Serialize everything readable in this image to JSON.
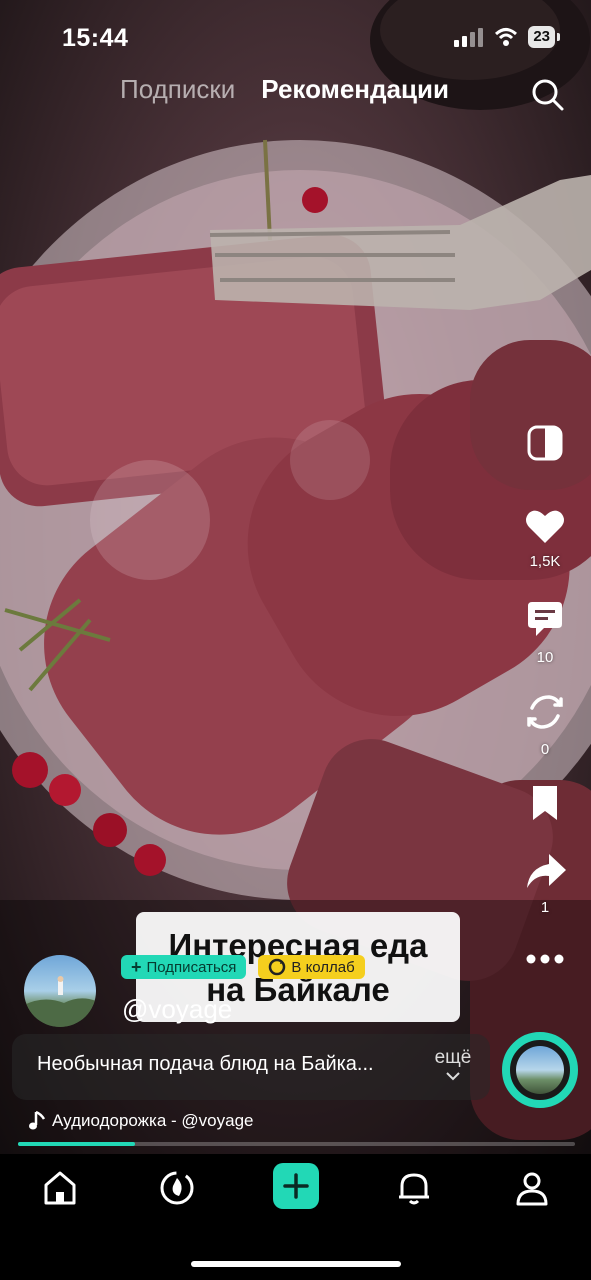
{
  "status_bar": {
    "time": "15:44",
    "battery": "23"
  },
  "top_tabs": {
    "following": "Подписки",
    "recommended": "Рекомендации"
  },
  "actions": {
    "likes": "1,5K",
    "comments": "10",
    "reposts": "0",
    "shares": "1"
  },
  "caption_overlay": {
    "line1": "Интересная еда",
    "line2": "на Байкале"
  },
  "author": {
    "username": "@voyage",
    "subscribe_label": "Подписаться",
    "collab_label": "В коллаб"
  },
  "description": {
    "text": "Необычная подача блюд на Байка...",
    "more_label": "ещё"
  },
  "audio": {
    "label": "Аудиодорожка - @voyage"
  },
  "playback": {
    "progress_fraction": 0.21
  },
  "colors": {
    "accent": "#22d8b6",
    "collab": "#f5cf1e"
  },
  "icons": {
    "search": "search-icon",
    "contrast": "contrast-icon",
    "like": "heart-icon",
    "comment": "comment-icon",
    "repost": "repost-icon",
    "bookmark": "bookmark-icon",
    "share": "share-icon",
    "more": "more-icon",
    "music": "music-note-icon",
    "home": "home-icon",
    "discover": "discover-icon",
    "add": "plus-icon",
    "notifications": "bell-icon",
    "profile": "profile-icon"
  }
}
